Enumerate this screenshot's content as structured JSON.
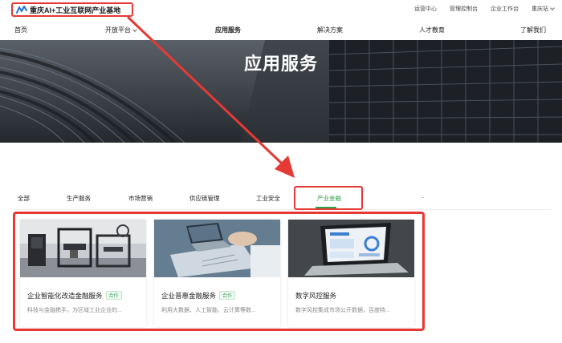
{
  "brand": {
    "name": "重庆AI+工业互联网产业基地",
    "accent_color": "#e53935",
    "logo_icon": "brand-logo-icon"
  },
  "top_links": [
    {
      "label": "运营中心"
    },
    {
      "label": "管理控制台"
    },
    {
      "label": "企业工作台"
    },
    {
      "label": "重庆站"
    }
  ],
  "nav": [
    {
      "label": "首页"
    },
    {
      "label": "开放平台"
    },
    {
      "label": "应用服务"
    },
    {
      "label": "解决方案"
    },
    {
      "label": "人才教育"
    },
    {
      "label": "了解我们"
    }
  ],
  "hero": {
    "title": "应用服务"
  },
  "tabs": [
    {
      "label": "全部"
    },
    {
      "label": "生产服务"
    },
    {
      "label": "市场营销"
    },
    {
      "label": "供应链管理"
    },
    {
      "label": "工业安全"
    },
    {
      "label": "产业金融"
    }
  ],
  "active_tab_color": "#2e9e4a",
  "cards": [
    {
      "title": "企业智能化改造金融服务",
      "badge": "合作",
      "desc": "科技与金融携手，为区域工业企业的..."
    },
    {
      "title": "企业普惠金融服务",
      "badge": "合作",
      "desc": "利用大数据、人工智能、云计算等数..."
    },
    {
      "title": "数字风控服务",
      "badge": "",
      "desc": "数字风控集成市场公开数据，百度特..."
    }
  ]
}
